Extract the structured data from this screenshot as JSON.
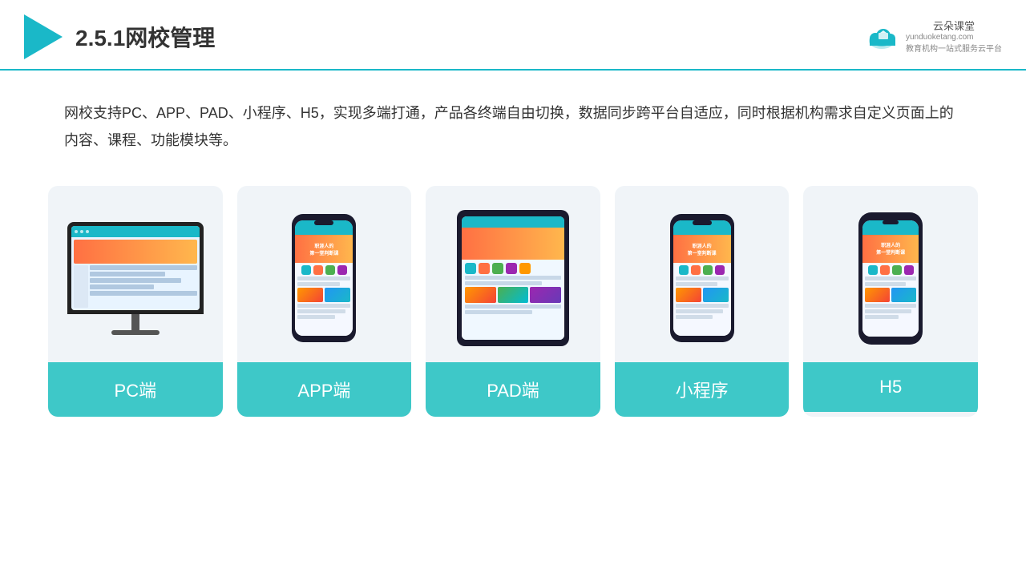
{
  "header": {
    "title": "2.5.1网校管理",
    "brand_name": "云朵课堂",
    "brand_url": "yunduoketang.com",
    "brand_tagline": "教育机构一站\n式服务云平台"
  },
  "description": {
    "text": "网校支持PC、APP、PAD、小程序、H5，实现多端打通，产品各终端自由切换，数据同步跨平台自适应，同时根据机构需求自定义页面上的内容、课程、功能模块等。"
  },
  "cards": [
    {
      "id": "pc",
      "label": "PC端"
    },
    {
      "id": "app",
      "label": "APP端"
    },
    {
      "id": "pad",
      "label": "PAD端"
    },
    {
      "id": "miniprogram",
      "label": "小程序"
    },
    {
      "id": "h5",
      "label": "H5"
    }
  ],
  "colors": {
    "accent": "#1ab8c8",
    "header_border": "#1ab8c8"
  }
}
